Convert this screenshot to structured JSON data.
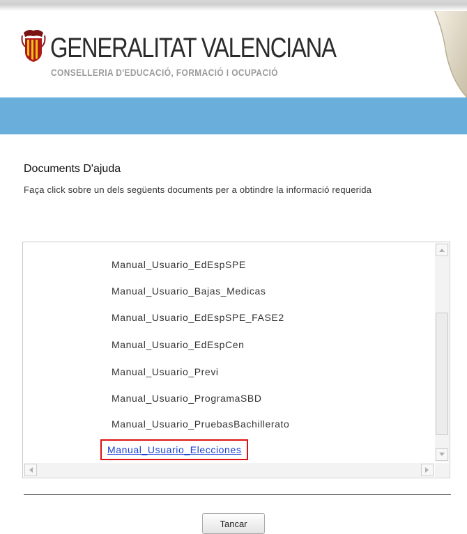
{
  "header": {
    "brand_title": "GENERALITAT VALENCIANA",
    "brand_subtitle": "CONSELLERIA D'EDUCACIÓ, FORMACIÓ I OCUPACIÓ",
    "band_color": "#6aaedc"
  },
  "main": {
    "title": "Documents D'ajuda",
    "description": "Faça click sobre un dels següents documents per a obtindre la informació requerida",
    "documents": [
      "Manual_Usuario_EdEspSPE",
      "Manual_Usuario_Bajas_Medicas",
      "Manual_Usuario_EdEspSPE_FASE2",
      "Manual_Usuario_EdEspCen",
      "Manual_Usuario_Previ",
      "Manual_Usuario_ProgramaSBD",
      "Manual_Usuario_PruebasBachillerato"
    ],
    "highlighted_document": "Manual_Usuario_Elecciones",
    "link_color": "#1a3fd3",
    "highlight_color": "#dd1111"
  },
  "footer": {
    "close_label": "Tancar"
  }
}
